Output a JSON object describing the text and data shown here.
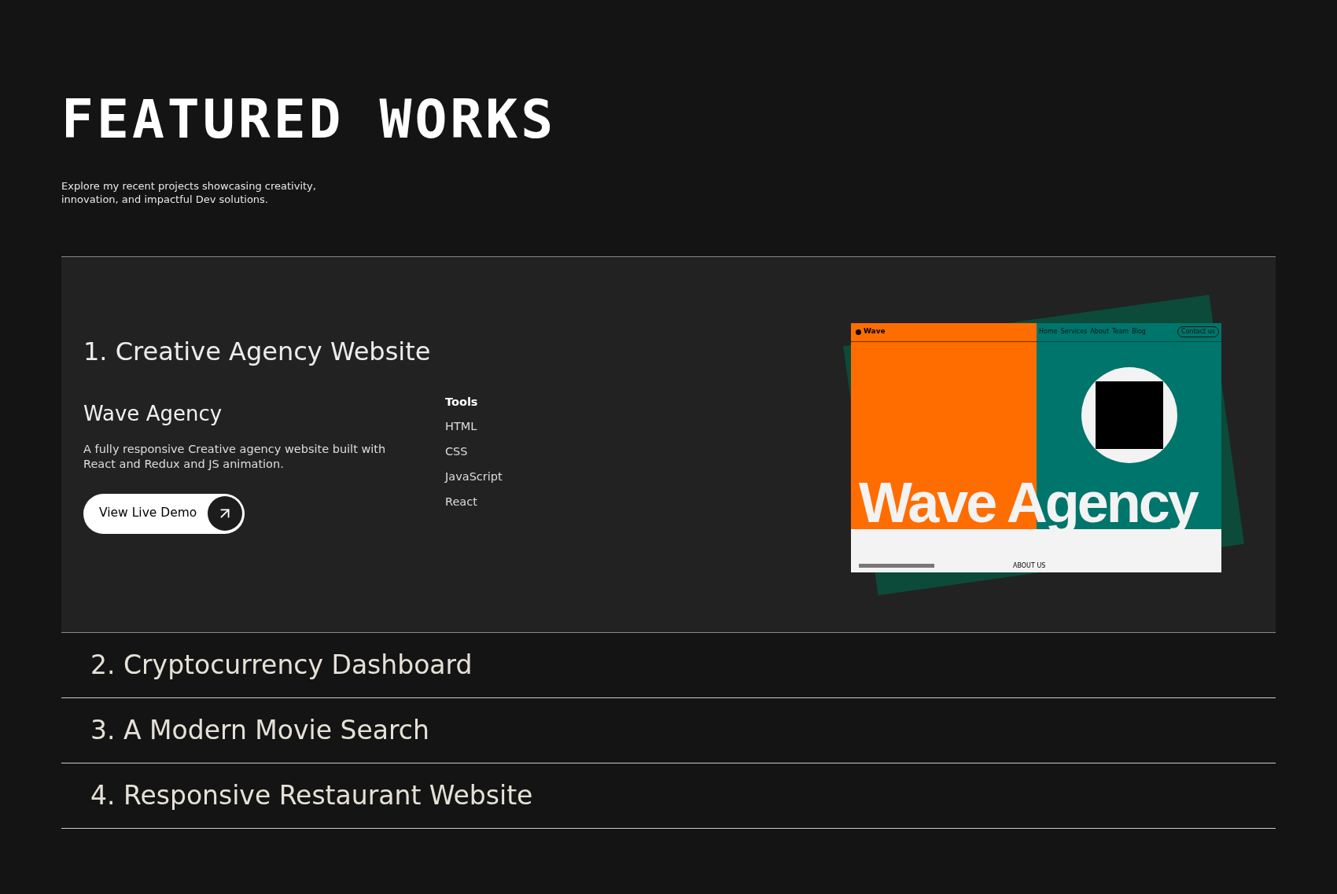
{
  "header": {
    "title": "FEATURED WORKS",
    "subtitle": "Explore my recent projects showcasing creativity, innovation, and impactful Dev solutions."
  },
  "projects": [
    {
      "number": "1.",
      "title": "Creative Agency Website",
      "expanded": true,
      "name": "Wave Agency",
      "description": "A fully responsive Creative agency website built with React and Redux and JS animation.",
      "button": "View Live Demo",
      "tools_heading": "Tools",
      "tools": [
        "HTML",
        "CSS",
        "JavaScript",
        "React"
      ],
      "preview": {
        "logo": "Wave",
        "nav": [
          "Home",
          "Services",
          "About",
          "Team",
          "Blog"
        ],
        "contact": "Contact us",
        "hero": "Wave Agency",
        "footer_label": "ABOUT US"
      }
    },
    {
      "number": "2.",
      "title": "Cryptocurrency Dashboard",
      "expanded": false
    },
    {
      "number": "3.",
      "title": "A Modern Movie Search",
      "expanded": false
    },
    {
      "number": "4.",
      "title": "Responsive Restaurant Website",
      "expanded": false
    }
  ]
}
